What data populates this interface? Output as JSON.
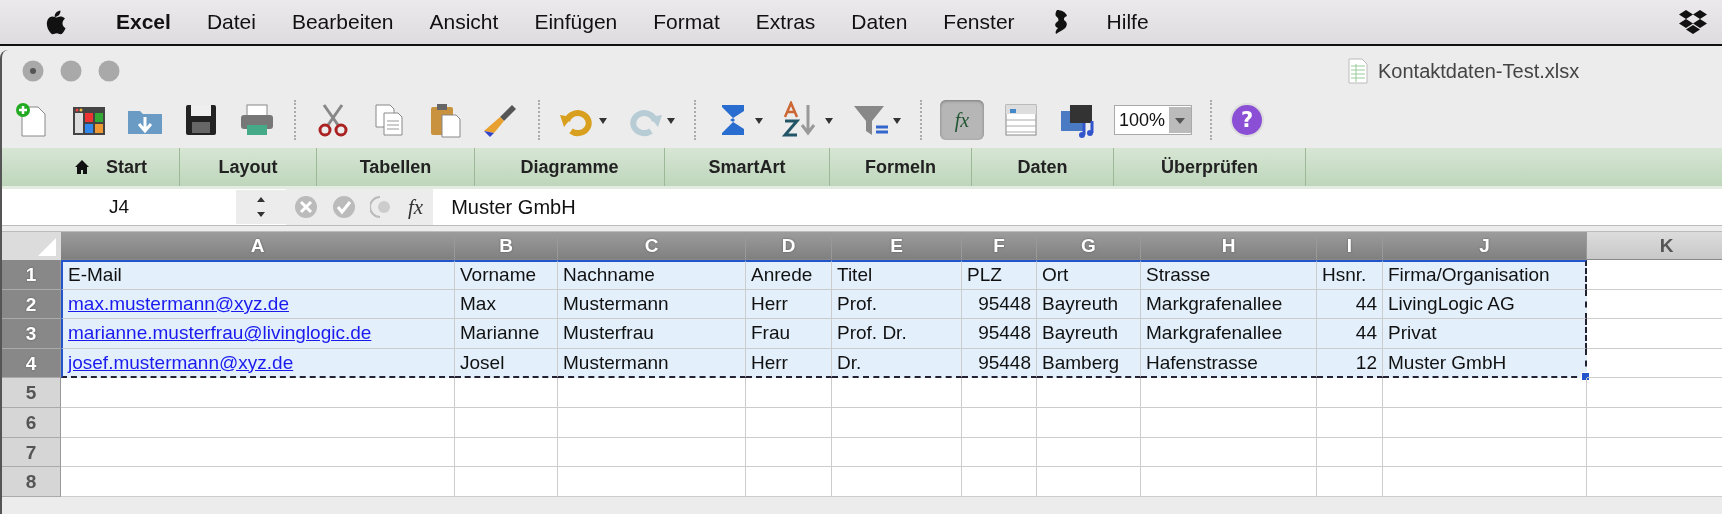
{
  "menu_bar": {
    "app_name": "Excel",
    "items": [
      "Datei",
      "Bearbeiten",
      "Ansicht",
      "Einfügen",
      "Format",
      "Extras",
      "Daten",
      "Fenster"
    ],
    "items_after_script": [
      "Hilfe"
    ]
  },
  "window": {
    "title": "Kontaktdaten-Test.xlsx"
  },
  "toolbar": {
    "formula_builder_label": "fx",
    "formula_builder_on": true,
    "zoom": "100%",
    "help_label": "?"
  },
  "ribbon_tabs": [
    {
      "label": "Start",
      "selected": false
    },
    {
      "label": "Layout",
      "selected": false
    },
    {
      "label": "Tabellen",
      "selected": false
    },
    {
      "label": "Diagramme",
      "selected": false
    },
    {
      "label": "SmartArt",
      "selected": false
    },
    {
      "label": "Formeln",
      "selected": false
    },
    {
      "label": "Daten",
      "selected": false
    },
    {
      "label": "Überprüfen",
      "selected": false
    }
  ],
  "formula_bar": {
    "cell_reference": "J4",
    "function_label": "fx",
    "value": "Muster GmbH"
  },
  "sheet": {
    "columns": [
      {
        "label": "A",
        "selected": true
      },
      {
        "label": "B",
        "selected": true
      },
      {
        "label": "C",
        "selected": true
      },
      {
        "label": "D",
        "selected": true
      },
      {
        "label": "E",
        "selected": true
      },
      {
        "label": "F",
        "selected": true
      },
      {
        "label": "G",
        "selected": true
      },
      {
        "label": "H",
        "selected": true
      },
      {
        "label": "I",
        "selected": true
      },
      {
        "label": "J",
        "selected": true
      },
      {
        "label": "K",
        "selected": false
      }
    ],
    "rows": [
      {
        "number": "1",
        "selected": true,
        "cells": [
          {
            "text": "E-Mail",
            "kind": "text"
          },
          {
            "text": "Vorname",
            "kind": "text"
          },
          {
            "text": "Nachname",
            "kind": "text"
          },
          {
            "text": "Anrede",
            "kind": "text"
          },
          {
            "text": "Titel",
            "kind": "text"
          },
          {
            "text": "PLZ",
            "kind": "text"
          },
          {
            "text": "Ort",
            "kind": "text"
          },
          {
            "text": "Strasse",
            "kind": "text"
          },
          {
            "text": "Hsnr.",
            "kind": "text"
          },
          {
            "text": "Firma/Organisation",
            "kind": "text"
          }
        ]
      },
      {
        "number": "2",
        "selected": true,
        "cells": [
          {
            "text": "max.mustermann@xyz.de",
            "kind": "link"
          },
          {
            "text": "Max",
            "kind": "text"
          },
          {
            "text": "Mustermann",
            "kind": "text"
          },
          {
            "text": "Herr",
            "kind": "text"
          },
          {
            "text": "Prof.",
            "kind": "text"
          },
          {
            "text": "95448",
            "kind": "number"
          },
          {
            "text": "Bayreuth",
            "kind": "text"
          },
          {
            "text": "Markgrafenallee",
            "kind": "text"
          },
          {
            "text": "44",
            "kind": "number"
          },
          {
            "text": "LivingLogic AG",
            "kind": "text"
          }
        ]
      },
      {
        "number": "3",
        "selected": true,
        "cells": [
          {
            "text": "marianne.musterfrau@livinglogic.de",
            "kind": "link"
          },
          {
            "text": "Marianne",
            "kind": "text"
          },
          {
            "text": "Musterfrau",
            "kind": "text"
          },
          {
            "text": "Frau",
            "kind": "text"
          },
          {
            "text": "Prof. Dr.",
            "kind": "text"
          },
          {
            "text": "95448",
            "kind": "number"
          },
          {
            "text": "Bayreuth",
            "kind": "text"
          },
          {
            "text": "Markgrafenallee",
            "kind": "text"
          },
          {
            "text": "44",
            "kind": "number"
          },
          {
            "text": "Privat",
            "kind": "text"
          }
        ]
      },
      {
        "number": "4",
        "selected": true,
        "cells": [
          {
            "text": "josef.mustermann@xyz.de",
            "kind": "link"
          },
          {
            "text": "Josel",
            "kind": "text"
          },
          {
            "text": "Mustermann",
            "kind": "text"
          },
          {
            "text": "Herr",
            "kind": "text"
          },
          {
            "text": "Dr.",
            "kind": "text"
          },
          {
            "text": "95448",
            "kind": "number"
          },
          {
            "text": "Bamberg",
            "kind": "text"
          },
          {
            "text": "Hafenstrasse",
            "kind": "text"
          },
          {
            "text": "12",
            "kind": "number"
          },
          {
            "text": "Muster GmbH",
            "kind": "text"
          }
        ]
      },
      {
        "number": "5",
        "selected": false,
        "cells": []
      },
      {
        "number": "6",
        "selected": false,
        "cells": []
      },
      {
        "number": "7",
        "selected": false,
        "cells": []
      },
      {
        "number": "8",
        "selected": false,
        "cells": []
      }
    ]
  }
}
